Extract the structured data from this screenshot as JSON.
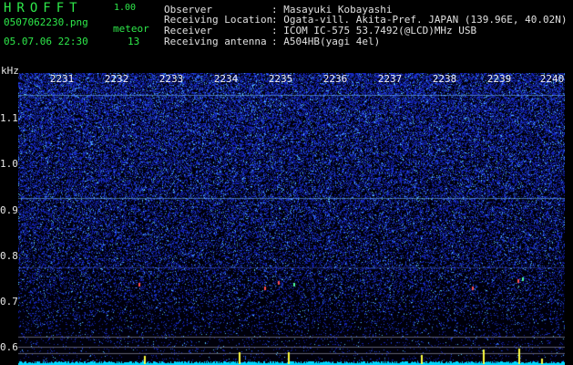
{
  "header": {
    "logo": "HROFFT",
    "version": "1.00",
    "filename": "0507062230.png",
    "datetime": "05.07.06 22:30",
    "meteor_label": "meteor",
    "meteor_count": "13",
    "info": [
      {
        "label": "Observer",
        "value": "Masayuki Kobayashi"
      },
      {
        "label": "Receiving Location",
        "value": "Ogata-vill. Akita-Pref. JAPAN (139.96E, 40.02N)"
      },
      {
        "label": "Receiver",
        "value": "ICOM IC-575 53.7492(@LCD)MHz USB"
      },
      {
        "label": "Receiving antenna",
        "value": "A504HB(yagi 4el)"
      }
    ]
  },
  "spectrogram": {
    "y_unit": "kHz",
    "y_ticks": [
      "1.1",
      "1.0",
      "0.9",
      "0.8",
      "0.7",
      "0.6"
    ],
    "time_labels": [
      "2231",
      "2232",
      "2233",
      "2234",
      "2235",
      "2236",
      "2237",
      "2238",
      "2239",
      "2240"
    ],
    "colors": {
      "background": "#000000",
      "noise": "#1a2aa0",
      "bright": "#5fd0ff",
      "trace": "#ffff40",
      "baseline": "#00e0ff"
    }
  }
}
